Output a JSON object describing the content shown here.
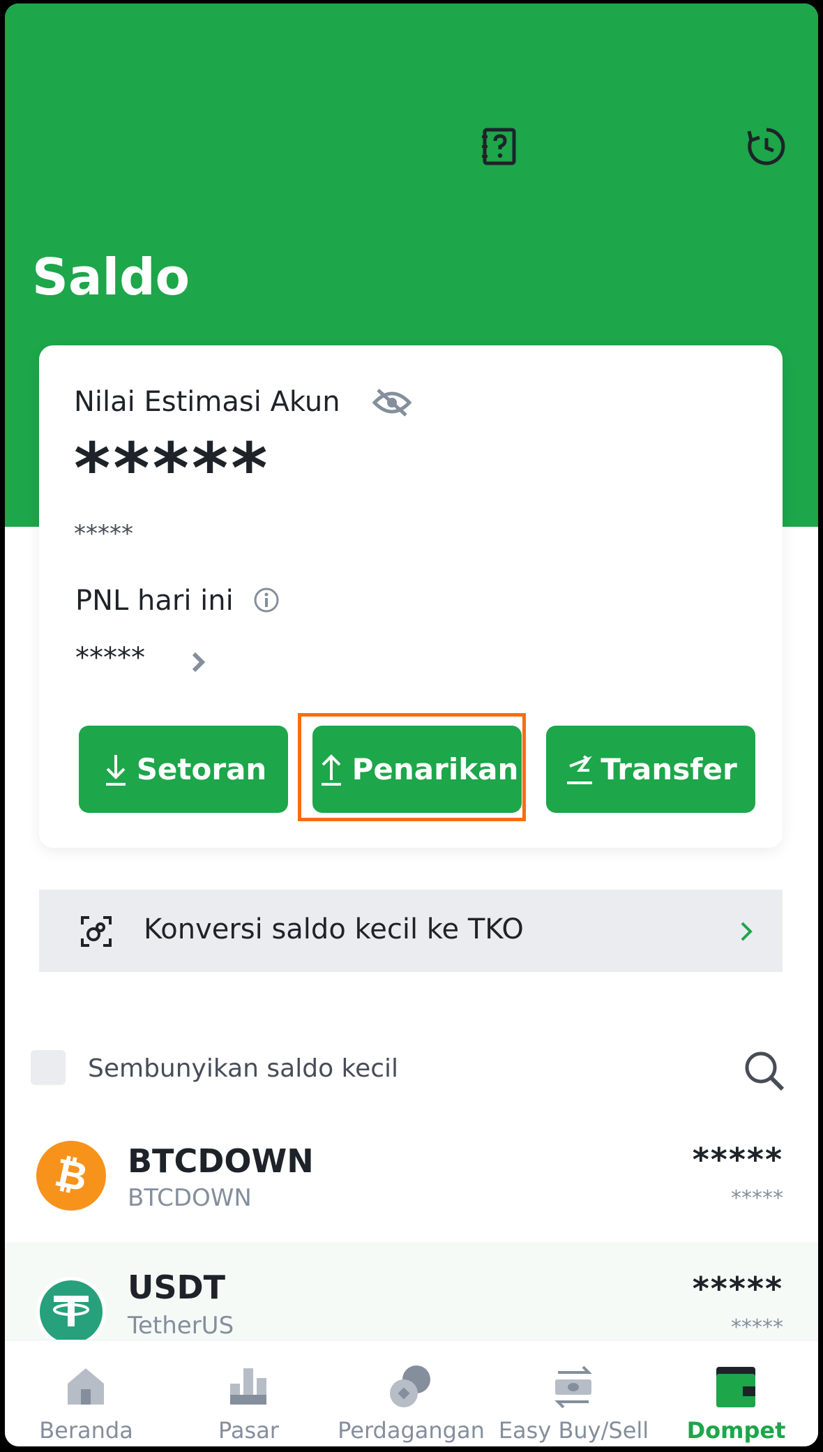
{
  "header": {
    "title": "Saldo",
    "help_icon": "help-book-icon",
    "history_icon": "history-clock-icon",
    "accent_color": "#1da64a"
  },
  "balance_card": {
    "estimate_label": "Nilai Estimasi Akun",
    "estimate_value": "*****",
    "estimate_sub_value": "*****",
    "pnl_label": "PNL hari ini",
    "pnl_value": "*****",
    "buttons": {
      "deposit": "Setoran",
      "withdraw": "Penarikan",
      "transfer": "Transfer"
    },
    "highlight_color": "#f76e11"
  },
  "convert_banner": {
    "label": "Konversi saldo kecil ke TKO"
  },
  "filter": {
    "hide_small_label": "Sembunyikan saldo kecil",
    "checked": false
  },
  "assets": [
    {
      "symbol": "BTCDOWN",
      "name": "BTCDOWN",
      "value": "*****",
      "sub_value": "*****",
      "icon": "bitcoin-icon",
      "color": "#f7931a"
    },
    {
      "symbol": "USDT",
      "name": "TetherUS",
      "value": "*****",
      "sub_value": "*****",
      "icon": "tether-icon",
      "color": "#26a17b"
    }
  ],
  "bottom_nav": [
    {
      "label": "Beranda",
      "icon": "home-icon"
    },
    {
      "label": "Pasar",
      "icon": "market-chart-icon"
    },
    {
      "label": "Perdagangan",
      "icon": "trade-coins-icon"
    },
    {
      "label": "Easy Buy/Sell",
      "icon": "exchange-cash-icon"
    },
    {
      "label": "Dompet",
      "icon": "wallet-icon",
      "active": true
    }
  ]
}
